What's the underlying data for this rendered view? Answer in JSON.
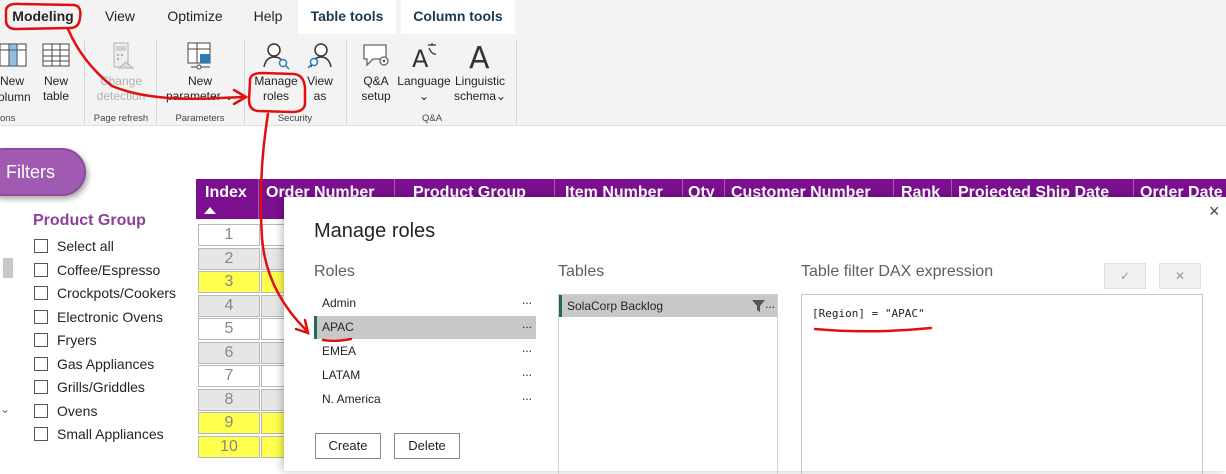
{
  "ribbon": {
    "tabs": [
      "Modeling",
      "View",
      "Optimize",
      "Help",
      "Table tools",
      "Column tools"
    ],
    "buttons": {
      "new_column": [
        "New",
        "column"
      ],
      "new_table": [
        "New",
        "table"
      ],
      "change_detection": [
        "Change",
        "detection"
      ],
      "new_parameter": [
        "New",
        "parameter"
      ],
      "manage_roles": [
        "Manage",
        "roles"
      ],
      "view_as": [
        "View",
        "as"
      ],
      "qa_setup": [
        "Q&A",
        "setup"
      ],
      "language": "Language",
      "linguistic_schema": [
        "Linguistic",
        "schema"
      ]
    },
    "groups": [
      "ons",
      "Page refresh",
      "Parameters",
      "Security",
      "Q&A"
    ]
  },
  "filters": {
    "button_label": "Filters",
    "slicer_title": "Product Group",
    "items": [
      "Select all",
      "Coffee/Espresso",
      "Crockpots/Cookers",
      "Electronic Ovens",
      "Fryers",
      "Gas Appliances",
      "Grills/Griddles",
      "Ovens",
      "Small Appliances"
    ]
  },
  "table": {
    "headers": [
      "Index",
      "Order Number",
      "Product Group",
      "Item Number",
      "Qty",
      "Customer Number",
      "Rank",
      "Projected Ship Date",
      "Order Date"
    ],
    "index_values": [
      "1",
      "2",
      "3",
      "4",
      "5",
      "6",
      "7",
      "8",
      "9",
      "10"
    ],
    "highlighted_rows": [
      "3",
      "9",
      "10"
    ],
    "colors": {
      "header": "#7b0f8f",
      "highlight": "#ffff4d",
      "alt_row": "#e6e6e6"
    }
  },
  "dialog": {
    "title": "Manage roles",
    "roles_header": "Roles",
    "tables_header": "Tables",
    "dax_header": "Table filter DAX expression",
    "roles": [
      "Admin",
      "APAC",
      "EMEA",
      "LATAM",
      "N. America"
    ],
    "selected_role": "APAC",
    "more_glyph": "...",
    "tables": [
      "SolaCorp Backlog"
    ],
    "dax_expression": "[Region] = \"APAC\"",
    "create_label": "Create",
    "delete_label": "Delete",
    "close_glyph": "×",
    "accept_glyph": "✓",
    "cancel_glyph": "✕"
  },
  "annotation_color": "#e01010"
}
